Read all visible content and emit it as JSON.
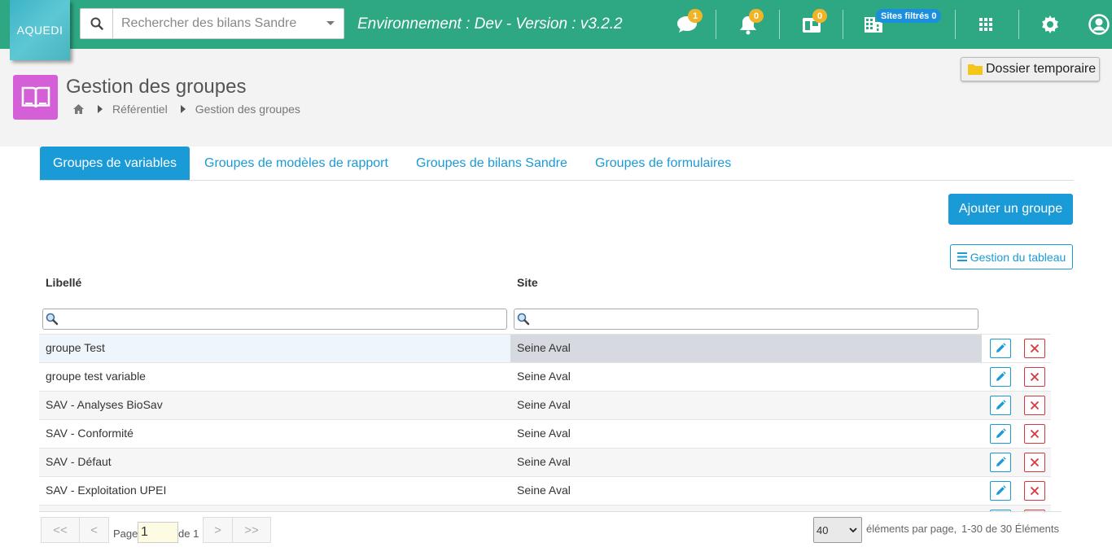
{
  "brand": {
    "logo_text": "AQUEDI",
    "accent": "#2da882",
    "primary": "#1a9ad6",
    "danger": "#d9363e"
  },
  "search": {
    "placeholder": "Rechercher des bilans Sandre",
    "icon": "search-icon"
  },
  "environment": "Environnement : Dev - Version : v3.2.2",
  "topbar": {
    "messages_count": "1",
    "notifications_count": "0",
    "tasks_count": "0",
    "sites_filter_label": "Sites filtrés 0"
  },
  "page": {
    "title": "Gestion des groupes",
    "breadcrumb": [
      "Référentiel",
      "Gestion des groupes"
    ],
    "temp_folder_label": "Dossier temporaire"
  },
  "tabs": [
    {
      "label": "Groupes de variables",
      "active": true
    },
    {
      "label": "Groupes de modèles de rapport",
      "active": false
    },
    {
      "label": "Groupes de bilans Sandre",
      "active": false
    },
    {
      "label": "Groupes de formulaires",
      "active": false
    }
  ],
  "actions": {
    "add_group": "Ajouter un groupe",
    "manage_table": "Gestion du tableau"
  },
  "table": {
    "columns": [
      "Libellé",
      "Site"
    ],
    "rows": [
      {
        "label": "groupe Test",
        "site": "Seine Aval"
      },
      {
        "label": "groupe test variable",
        "site": "Seine Aval"
      },
      {
        "label": "SAV - Analyses BioSav",
        "site": "Seine Aval"
      },
      {
        "label": "SAV - Conformité",
        "site": "Seine Aval"
      },
      {
        "label": "SAV - Défaut",
        "site": "Seine Aval"
      },
      {
        "label": "SAV - Exploitation UPEI",
        "site": "Seine Aval"
      }
    ]
  },
  "pagination": {
    "first": "<<",
    "prev": "<",
    "next": ">",
    "last": ">>",
    "page_label": "Page",
    "current_page": "1",
    "of_label": "de 1",
    "per_page": "40",
    "per_page_label": "éléments par page,",
    "range_label": "1-30 de 30 Éléments"
  }
}
